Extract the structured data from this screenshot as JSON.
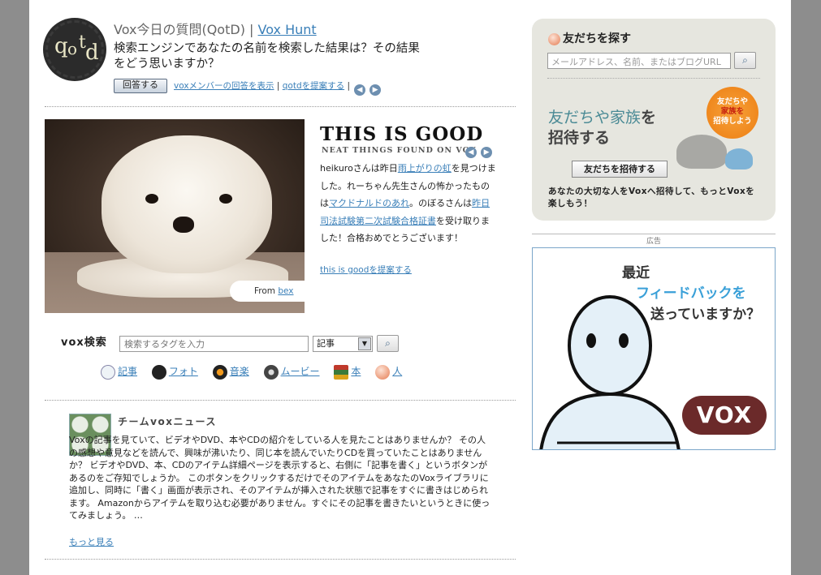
{
  "qotd": {
    "badge_text": "qotd",
    "title": "Vox今日の質問(QotD) |",
    "title_link": "Vox Hunt",
    "question": "検索エンジンであなたの名前を検索した結果は？その結果をどう思いますか？",
    "answer_button": "回答する",
    "link_members": "voxメンバーの回答を表示",
    "link_suggest": "qotdを提案する",
    "prev_icon": "arrow-left-icon",
    "next_icon": "arrow-right-icon"
  },
  "this_is_good": {
    "title": "THIS IS GOOD",
    "subtitle": "NEAT THINGS FOUND ON VOX",
    "from_label": "From",
    "from_user": "bex",
    "body": {
      "p1": "heikuroさんは昨日",
      "l1": "雨上がりの虹",
      "p2": "を見つけました。れーちゃん先生さんの怖かったものは",
      "l2": "マクドナルドのあれ",
      "p3": "。のぼるさんは",
      "l3": "昨日司法試験第二次試験合格証書",
      "p4": "を受け取りました！合格おめでとうございます！"
    },
    "suggest_link": "this is goodを提案する"
  },
  "search": {
    "label": "vox検索",
    "placeholder": "検索するタグを入力",
    "selected": "記事",
    "button_icon": "magnifier-icon",
    "categories": [
      "記事",
      "フォト",
      "音楽",
      "ムービー",
      "本",
      "人"
    ]
  },
  "news": {
    "title": "チームvoxニュース",
    "body": "Voxの記事を見ていて、ビデオやDVD、本やCDの紹介をしている人を見たことはありませんか？ その人の感想や意見などを読んで、興味が沸いたり、同じ本を読んでいたりCDを買っていたことはありませんか？ ビデオやDVD、本、CDのアイテム詳細ページを表示すると、右側に「記事を書く」というボタンがあるのをご存知でしょうか。 このボタンをクリックするだけでそのアイテムをあなたのVoxライブラリに追加し、同時に「書く」画面が表示され、そのアイテムが挿入された状態で記事をすぐに書きはじめられます。 Amazonからアイテムを取り込む必要がありません。すぐにその記事を書きたいというときに使ってみましょう。 …",
    "more": "もっと見る"
  },
  "friends": {
    "title": "友だちを探す",
    "placeholder": "メールアドレス、名前、またはブログURL",
    "invite_title_a": "友だちや家族",
    "invite_title_b": "を",
    "invite_title_c": "招待する",
    "badge_a": "友だちや",
    "badge_b": "家族を",
    "badge_c": "招待しよう",
    "invite_button": "友だちを招待する",
    "invite_desc": "あなたの大切な人をVoxへ招待して、もっとVoxを楽しもう！"
  },
  "ad": {
    "label": "広告",
    "line1": "最近",
    "line2": "フィードバックを",
    "line3": "送っていますか？",
    "brand": "VOX"
  }
}
